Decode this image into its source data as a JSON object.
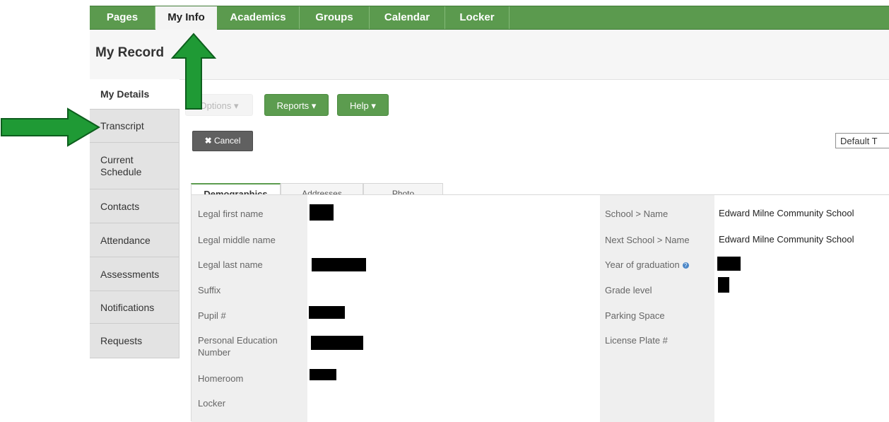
{
  "topnav": {
    "tabs": [
      {
        "label": "Pages"
      },
      {
        "label": "My Info"
      },
      {
        "label": "Academics"
      },
      {
        "label": "Groups"
      },
      {
        "label": "Calendar"
      },
      {
        "label": "Locker"
      }
    ],
    "active_tab": "My Info"
  },
  "page_title": "My Record",
  "sidebar": {
    "items": [
      {
        "label": "My Details"
      },
      {
        "label": "Transcript"
      },
      {
        "label": "Current\nSchedule"
      },
      {
        "label": "Contacts"
      },
      {
        "label": "Attendance"
      },
      {
        "label": "Assessments"
      },
      {
        "label": "Notifications"
      },
      {
        "label": "Requests"
      }
    ],
    "active_item": "My Details"
  },
  "toolbar": {
    "options_label": "Options",
    "reports_label": "Reports",
    "help_label": "Help",
    "cancel_label": "Cancel",
    "dropdown_caret": "▾"
  },
  "template_select": {
    "value": "Default T"
  },
  "subtabs": {
    "items": [
      {
        "label": "Demographics"
      },
      {
        "label": "Addresses"
      },
      {
        "label": "Photo"
      }
    ],
    "active": "Demographics"
  },
  "form_left": {
    "fields": [
      {
        "label": "Legal first name",
        "value_redacted": true
      },
      {
        "label": "Legal middle name",
        "value_redacted": false
      },
      {
        "label": "Legal last name",
        "value_redacted": true
      },
      {
        "label": "Suffix",
        "value_redacted": false
      },
      {
        "label": "Pupil #",
        "value_redacted": true
      },
      {
        "label": "Personal Education\nNumber",
        "value_redacted": true
      },
      {
        "label": "Homeroom",
        "value_redacted": true
      },
      {
        "label": "Locker",
        "value_redacted": false
      }
    ]
  },
  "form_right": {
    "fields": [
      {
        "label": "School > Name",
        "value": "Edward Milne Community School"
      },
      {
        "label": "Next School > Name",
        "value": "Edward Milne Community School"
      },
      {
        "label": "Year of graduation",
        "value_redacted": true,
        "info_icon": true
      },
      {
        "label": "Grade level",
        "value_redacted": true
      },
      {
        "label": "Parking Space",
        "value": ""
      },
      {
        "label": "License Plate #",
        "value": ""
      }
    ]
  },
  "colors": {
    "nav_green": "#5b9a4e",
    "button_green": "#5c9c4f",
    "arrow_green": "#1f9a35",
    "redaction": "#000000"
  },
  "annotations": {
    "arrow_up_target": "My Info",
    "arrow_right_target": "Transcript"
  }
}
